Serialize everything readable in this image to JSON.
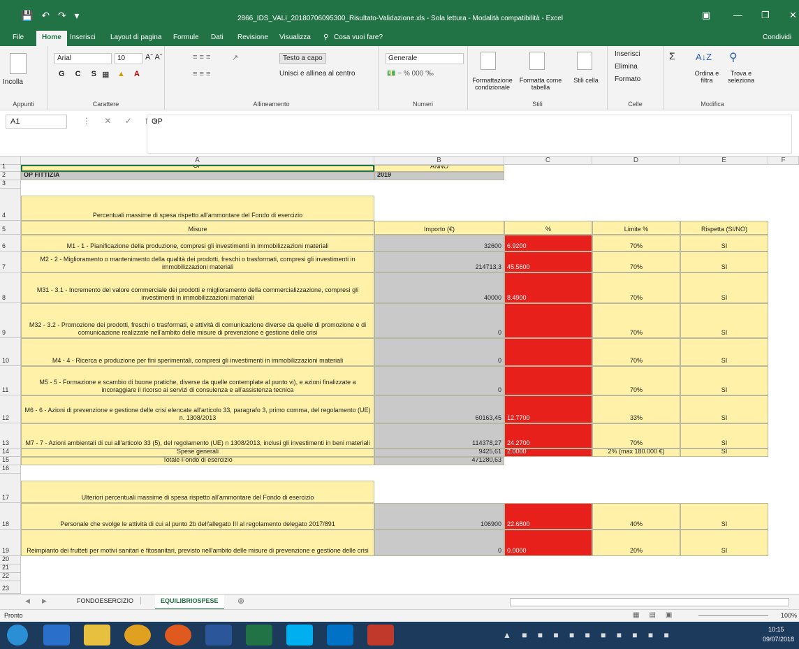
{
  "window": {
    "title": "2866_IDS_VALI_20180706095300_Risultato-Validazione.xls - Sola lettura - Modalità compatibilità - Excel",
    "share": "Condividi"
  },
  "menu": {
    "items": [
      "File",
      "Home",
      "Inserisci",
      "Layout di pagina",
      "Formule",
      "Dati",
      "Revisione",
      "Visualizza"
    ],
    "tellme": "Cosa vuoi fare?"
  },
  "ribbon": {
    "paste": "Incolla",
    "clipboard": "Appunti",
    "font_name": "Arial",
    "font_size": "10",
    "font_group": "Carattere",
    "wrap_text": "Testo a capo",
    "merge": "Unisci e allinea al centro",
    "align_group": "Allineamento",
    "number_format": "Generale",
    "number_group": "Numeri",
    "cond_format": "Formattazione condizionale",
    "format_table": "Formatta come tabella",
    "cell_styles": "Stili cella",
    "styles_group": "Stili",
    "insert": "Inserisci",
    "delete": "Elimina",
    "format": "Formato",
    "cells_group": "Celle",
    "sort_filter": "Ordina e filtra",
    "find_select": "Trova e seleziona",
    "edit_group": "Modifica"
  },
  "formula_bar": {
    "name_box": "A1",
    "content": "OP"
  },
  "columns": [
    "A",
    "B",
    "C",
    "D",
    "E",
    "F"
  ],
  "sheet": {
    "r1": {
      "a": "OP",
      "b": "ANNO"
    },
    "r2": {
      "a": "OP FITTIZIA",
      "b": "2019"
    },
    "r4": {
      "a": "Percentuali massime di spesa rispetto all'ammontare del Fondo di esercizio"
    },
    "r5": {
      "a": "Misure",
      "b": "Importo (€)",
      "c": "%",
      "d": "Limite %",
      "e": "Rispetta (SI/NO)"
    },
    "rows": [
      {
        "n": "6",
        "a": "M1 - 1 - Pianificazione della produzione, compresi gli investimenti in immobilizzazioni materiali",
        "b": "32600",
        "c": "6.9200",
        "d": "70%",
        "e": "SI"
      },
      {
        "n": "7",
        "a": "M2 - 2 - Miglioramento o mantenimento della qualità dei prodotti, freschi o trasformati, compresi gli investimenti in immobilizzazioni materiali",
        "b": "214713,3",
        "c": "45.5600",
        "d": "70%",
        "e": "SI"
      },
      {
        "n": "8",
        "a": "M31 - 3.1 - Incremento del valore commerciale dei prodotti e miglioramento della commercializzazione, compresi gli investimenti in immobilizzazioni materiali",
        "b": "40000",
        "c": "8.4900",
        "d": "70%",
        "e": "SI"
      },
      {
        "n": "9",
        "a": "M32 - 3.2 - Promozione dei prodotti, freschi o trasformati, e attività di comunicazione diverse da quelle di promozione e di comunicazione realizzate nell'ambito delle misure di prevenzione e gestione delle crisi",
        "b": "0",
        "c": "",
        "d": "70%",
        "e": "SI"
      },
      {
        "n": "10",
        "a": "M4 - 4 - Ricerca e produzione per fini sperimentali, compresi gli investimenti in immobilizzazioni materiali",
        "b": "0",
        "c": "",
        "d": "70%",
        "e": "SI"
      },
      {
        "n": "11",
        "a": "M5 - 5 - Formazione e scambio di buone pratiche, diverse da quelle contemplate al punto vi), e azioni finalizzate a incoraggiare il ricorso ai servizi di consulenza e all'assistenza tecnica",
        "b": "0",
        "c": "",
        "d": "70%",
        "e": "SI"
      },
      {
        "n": "12",
        "a": "M6 - 6 - Azioni di prevenzione e gestione delle crisi elencate all'articolo 33, paragrafo 3, primo comma, del regolamento (UE) n. 1308/2013",
        "b": "60163,45",
        "c": "12.7700",
        "d": "33%",
        "e": "SI"
      },
      {
        "n": "13",
        "a": "M7 - 7 - Azioni ambientali di cui all'articolo 33 (5), del regolamento (UE) n 1308/2013, inclusi gli investimenti in beni materiali",
        "b": "114378,27",
        "c": "24.2700",
        "d": "70%",
        "e": "SI"
      }
    ],
    "r14": {
      "a": "Spese generali",
      "b": "9425,61",
      "c": "2.0000",
      "d": "2% (max 180.000 €)",
      "e": "SI"
    },
    "r15": {
      "a": "Totale Fondo di esercizio",
      "b": "471280,63"
    },
    "r17": {
      "a": "Ulteriori percentuali massime di spesa rispetto all'ammontare del Fondo di esercizio"
    },
    "r18": {
      "a": "Personale che svolge le attività di cui al punto 2b dell'allegato III al regolamento delegato 2017/891",
      "b": "106900",
      "c": "22.6800",
      "d": "40%",
      "e": "SI"
    },
    "r19": {
      "a": "Reimpianto dei frutteti per motivi sanitari e fitosanitari, previsto nell'ambito delle misure di prevenzione e gestione delle crisi",
      "b": "0",
      "c": "0.0000",
      "d": "20%",
      "e": "SI"
    }
  },
  "row_numbers": [
    "1",
    "2",
    "3",
    "4",
    "5",
    "16",
    "20",
    "21",
    "22",
    "23"
  ],
  "tabs": [
    "FONDOESERCIZIO",
    "EQUILIBRIOSPESE"
  ],
  "status": {
    "ready": "Pronto",
    "zoom": "100%"
  },
  "clock": {
    "time": "10:15",
    "date": "09/07/2018"
  }
}
